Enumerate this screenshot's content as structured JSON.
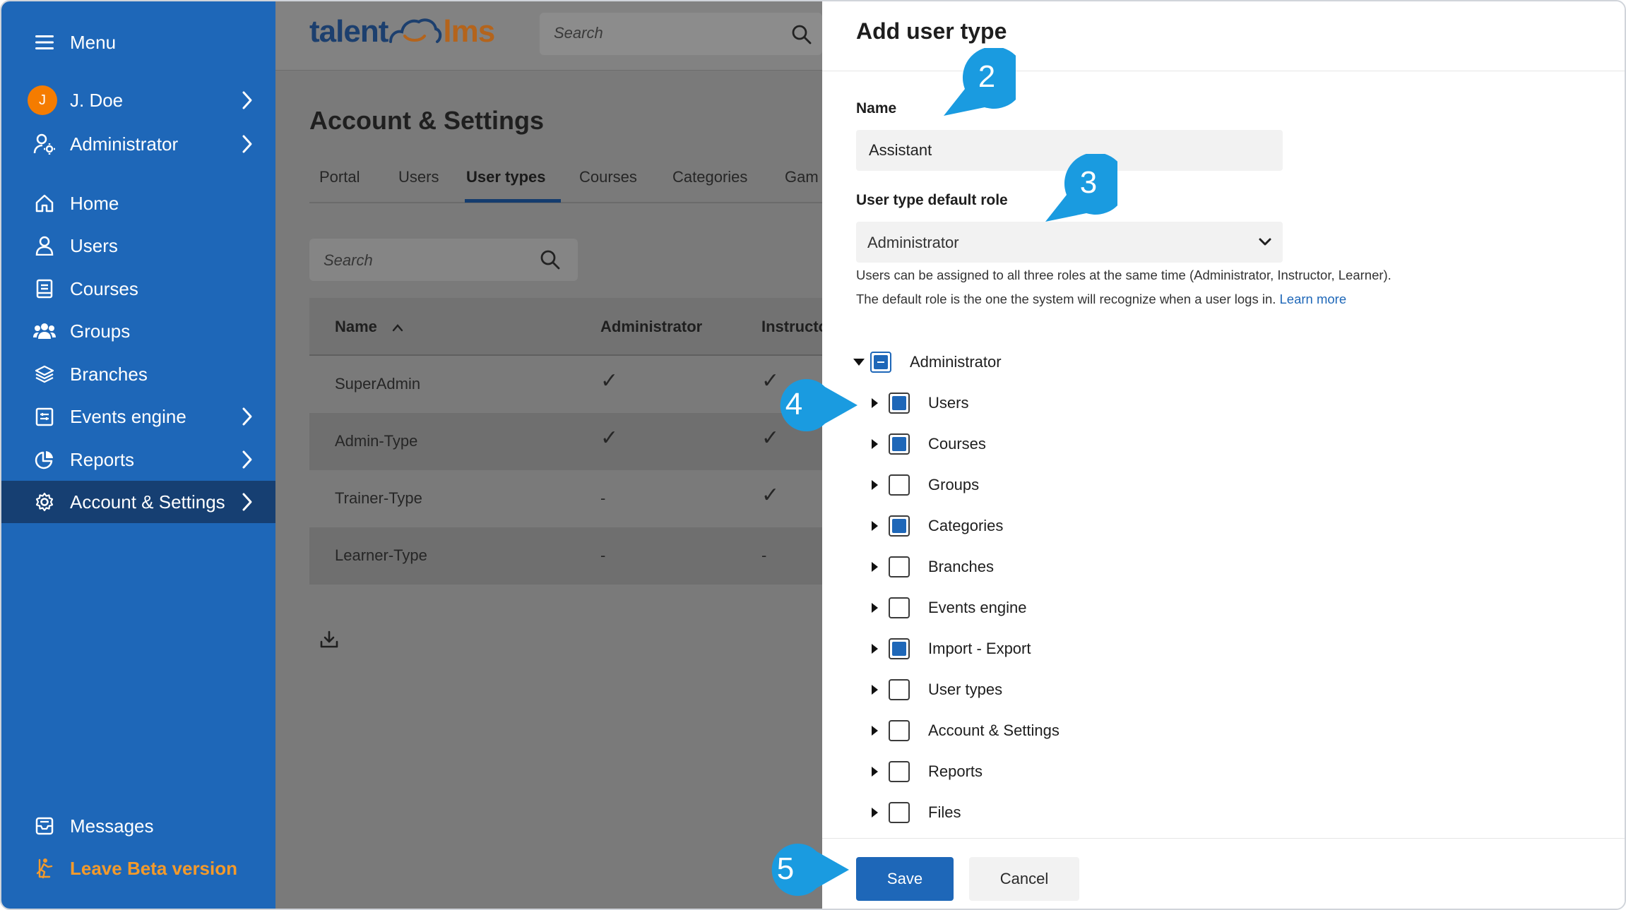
{
  "sidebar": {
    "menu_label": "Menu",
    "user_initial": "J",
    "user_name": "J. Doe",
    "role": "Administrator",
    "items": [
      {
        "label": "Home",
        "icon": "home-icon"
      },
      {
        "label": "Users",
        "icon": "user-icon"
      },
      {
        "label": "Courses",
        "icon": "book-icon"
      },
      {
        "label": "Groups",
        "icon": "group-icon"
      },
      {
        "label": "Branches",
        "icon": "layers-icon"
      },
      {
        "label": "Events engine",
        "icon": "events-icon"
      },
      {
        "label": "Reports",
        "icon": "pie-chart-icon"
      },
      {
        "label": "Account & Settings",
        "icon": "gear-icon"
      }
    ],
    "messages_label": "Messages",
    "leave_beta_label": "Leave Beta version"
  },
  "header": {
    "logo_part1": "talent",
    "logo_part2": "lms",
    "search_placeholder": "Search"
  },
  "page": {
    "title": "Account & Settings",
    "tabs": [
      "Portal",
      "Users",
      "User types",
      "Courses",
      "Categories",
      "Gam"
    ],
    "active_tab": "User types",
    "search_placeholder": "Search"
  },
  "table": {
    "columns": [
      "Name",
      "Administrator",
      "Instructo"
    ],
    "rows": [
      {
        "name": "SuperAdmin",
        "admin": "✓",
        "instructor": "✓"
      },
      {
        "name": "Admin-Type",
        "admin": "✓",
        "instructor": "✓"
      },
      {
        "name": "Trainer-Type",
        "admin": "-",
        "instructor": "✓"
      },
      {
        "name": "Learner-Type",
        "admin": "-",
        "instructor": "-"
      }
    ]
  },
  "panel": {
    "title": "Add user type",
    "name_label": "Name",
    "name_value": "Assistant",
    "role_label": "User type default role",
    "role_value": "Administrator",
    "help_line1": "Users can be assigned to all three roles at the same time (Administrator, Instructor, Learner).",
    "help_line2": "The default role is the one the system will recognize when a user logs in.",
    "learn_more": "Learn more",
    "tree_root": "Administrator",
    "tree_items": [
      {
        "label": "Users",
        "checked": true
      },
      {
        "label": "Courses",
        "checked": true
      },
      {
        "label": "Groups",
        "checked": false
      },
      {
        "label": "Categories",
        "checked": true
      },
      {
        "label": "Branches",
        "checked": false
      },
      {
        "label": "Events engine",
        "checked": false
      },
      {
        "label": "Import - Export",
        "checked": true
      },
      {
        "label": "User types",
        "checked": false
      },
      {
        "label": "Account & Settings",
        "checked": false
      },
      {
        "label": "Reports",
        "checked": false
      },
      {
        "label": "Files",
        "checked": false
      }
    ],
    "save_label": "Save",
    "cancel_label": "Cancel"
  },
  "callouts": [
    "2",
    "3",
    "4",
    "5"
  ],
  "colors": {
    "sidebar_bg": "#1e67b8",
    "sidebar_active": "#163f72",
    "primary": "#1e67b8",
    "callout": "#1a9be0",
    "beta_orange": "#f39a2b"
  }
}
